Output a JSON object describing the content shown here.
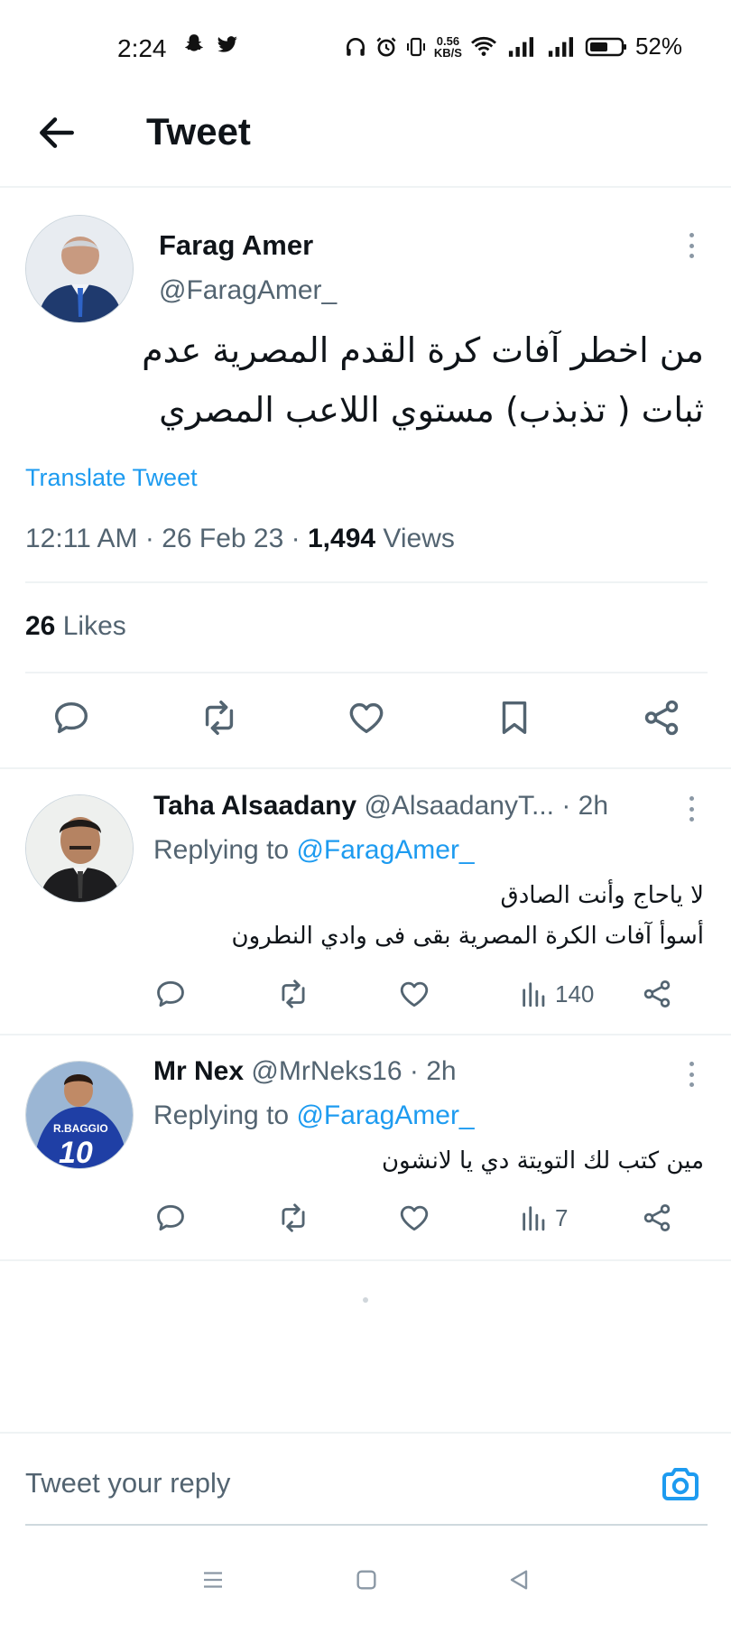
{
  "status_bar": {
    "time": "2:24",
    "net_speed_top": "0.56",
    "net_speed_bottom": "KB/S",
    "battery": "52%"
  },
  "header": {
    "title": "Tweet"
  },
  "tweet": {
    "author_name": "Farag Amer",
    "author_handle": "@FaragAmer_",
    "text_line1": "من اخطر آفات كرة القدم المصرية عدم",
    "text_line2": "ثبات ( تذبذب) مستوي اللاعب المصري",
    "translate_label": "Translate Tweet",
    "time": "12:11 AM",
    "date": "26 Feb 23",
    "views_count": "1,494",
    "views_label": "Views",
    "likes_count": "26",
    "likes_label": "Likes"
  },
  "replies": [
    {
      "name": "Taha Alsaadany",
      "handle": "@AlsaadanyT...",
      "age": "· 2h",
      "replying_label": "Replying to",
      "replying_to": "@FaragAmer_",
      "line1": "لا ياحاج وأنت الصادق",
      "line2": "أسوأ آفات الكرة المصرية بقى فى وادي النطرون",
      "views": "140"
    },
    {
      "name": "Mr Nex",
      "handle": "@MrNeks16",
      "age": "· 2h",
      "replying_label": "Replying to",
      "replying_to": "@FaragAmer_",
      "line1": "مين كتب لك التويتة دي يا لانشون",
      "views": "7",
      "avatar_jersey_name": "R.BAGGIO",
      "avatar_jersey_number": "10"
    }
  ],
  "reply_box": {
    "placeholder": "Tweet your reply"
  },
  "colors": {
    "accent": "#1d9bf0",
    "secondary_text": "#536471",
    "divider": "#eff3f4"
  },
  "icons": [
    "back-arrow-icon",
    "reply-icon",
    "retweet-icon",
    "like-icon",
    "bookmark-icon",
    "share-icon",
    "views-icon",
    "more-icon",
    "camera-icon"
  ]
}
